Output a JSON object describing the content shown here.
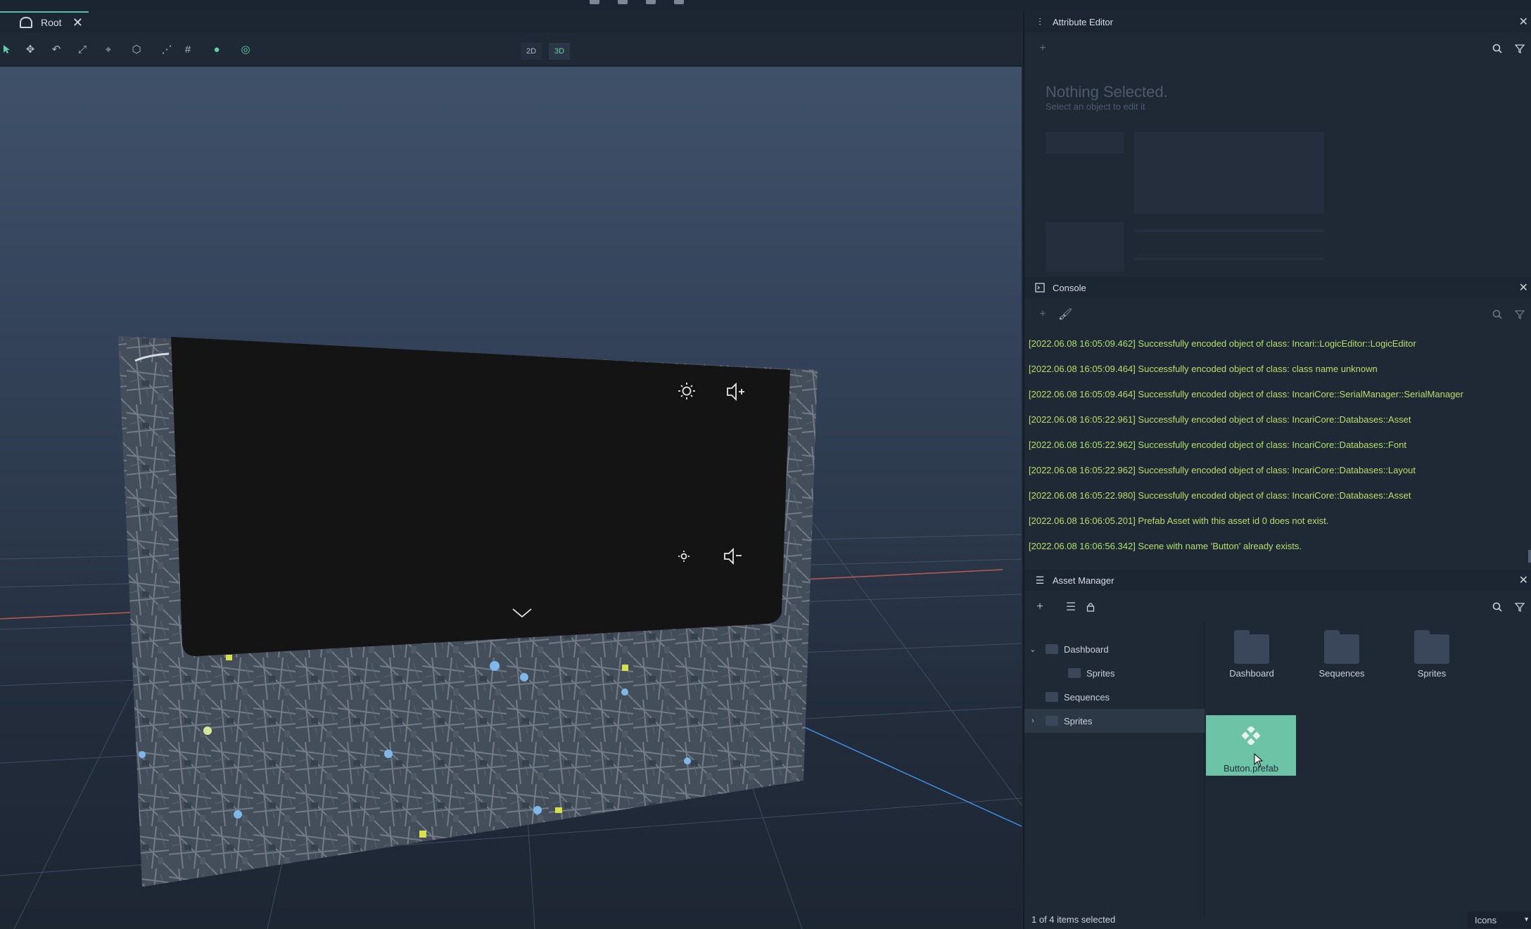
{
  "scene_tab": {
    "label": "Root"
  },
  "viewport_modes": {
    "mode_2d": "2D",
    "mode_3d": "3D"
  },
  "viewport_tools": [
    "select-tool",
    "move-tool",
    "rotate-tool",
    "scale-tool",
    "pin-tool",
    "cube-tool",
    "path-tool",
    "grid-tool",
    "light-tool",
    "camera-tool"
  ],
  "attribute_editor": {
    "title": "Attribute Editor",
    "empty_title": "Nothing Selected.",
    "empty_subtitle": "Select an object to edit it"
  },
  "console": {
    "title": "Console",
    "lines": [
      "[2022.06.08 16:05:09.462] Successfully encoded object of class: Incari::LogicEditor::LogicEditor",
      "[2022.06.08 16:05:09.464] Successfully encoded object of class: class name unknown",
      "[2022.06.08 16:05:09.464] Successfully encoded object of class: IncariCore::SerialManager::SerialManager",
      "[2022.06.08 16:05:22.961] Successfully encoded object of class: IncariCore::Databases::Asset",
      "[2022.06.08 16:05:22.962] Successfully encoded object of class: IncariCore::Databases::Font",
      "[2022.06.08 16:05:22.962] Successfully encoded object of class: IncariCore::Databases::Layout",
      "[2022.06.08 16:05:22.980] Successfully encoded object of class: IncariCore::Databases::Asset",
      "[2022.06.08 16:06:05.201] Prefab Asset with this asset id 0 does not exist.",
      "[2022.06.08 16:06:56.342] Scene with name 'Button' already exists."
    ],
    "log_color": "#b9df6a"
  },
  "asset_manager": {
    "title": "Asset Manager",
    "tree": [
      {
        "label": "Dashboard",
        "expanded": true
      },
      {
        "label": "Sprites"
      },
      {
        "label": "Sequences"
      },
      {
        "label": "Sprites",
        "collapsed": true,
        "selected": true
      }
    ],
    "grid_folders": [
      "Dashboard",
      "Sequences",
      "Sprites"
    ],
    "selected_asset": "Button.prefab",
    "status": "1 of 4 items selected",
    "view_mode": "Icons"
  },
  "colors": {
    "accent": "#5fd0a8",
    "selected_tile": "#6cc3a5",
    "panel_bg": "#1f2835",
    "header_bg": "#1c2532"
  }
}
